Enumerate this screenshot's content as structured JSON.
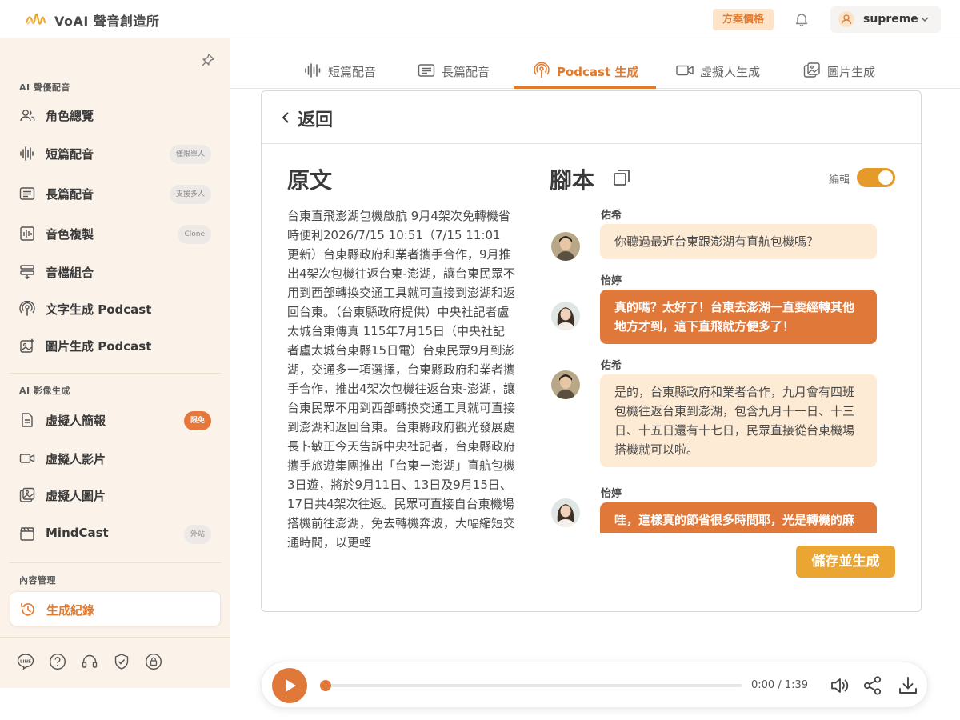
{
  "header": {
    "app_title": "VoAI 聲音創造所",
    "pricing_label": "方案價格",
    "user_name": "supreme"
  },
  "sidebar": {
    "sections": [
      {
        "title": "AI 聲優配音"
      },
      {
        "title": "AI 影像生成"
      },
      {
        "title": "內容管理"
      }
    ],
    "items": [
      {
        "label": "角色總覽",
        "icon": "users-icon"
      },
      {
        "label": "短篇配音",
        "badge": "僅限單人",
        "icon": "waveform-icon"
      },
      {
        "label": "長篇配音",
        "badge": "支援多人",
        "icon": "list-doc-icon"
      },
      {
        "label": "音色複製",
        "badge": "Clone",
        "icon": "voice-clone-icon"
      },
      {
        "label": "音檔組合",
        "icon": "audio-merge-icon"
      },
      {
        "label": "文字生成 Podcast",
        "icon": "podcast-icon"
      },
      {
        "label": "圖片生成 Podcast",
        "icon": "image-sparkle-icon"
      },
      {
        "label": "虛擬人簡報",
        "badge": "限免",
        "icon": "document-icon"
      },
      {
        "label": "虛擬人影片",
        "icon": "video-icon"
      },
      {
        "label": "虛擬人圖片",
        "icon": "image-icon"
      },
      {
        "label": "MindCast",
        "badge": "外站",
        "icon": "clapper-icon"
      },
      {
        "label": "生成紀錄",
        "icon": "history-icon"
      }
    ]
  },
  "tabs": [
    {
      "label": "短篇配音",
      "icon": "waveform-icon"
    },
    {
      "label": "長篇配音",
      "icon": "list-doc-icon"
    },
    {
      "label": "Podcast 生成",
      "icon": "podcast-icon"
    },
    {
      "label": "虛擬人生成",
      "icon": "video-icon"
    },
    {
      "label": "圖片生成",
      "icon": "image-icon"
    }
  ],
  "panel": {
    "back_label": "返回",
    "original_title": "原文",
    "original_text": "台東直飛澎湖包機啟航 9月4架次免轉機省時便利2026/7/15 10:51（7/15 11:01 更新）台東縣政府和業者攜手合作，9月推出4架次包機往返台東-澎湖，讓台東民眾不用到西部轉換交通工具就可直接到澎湖和返回台東。（台東縣政府提供）中央社記者盧太城台東傳真 115年7月15日（中央社記者盧太城台東縣15日電）台東民眾9月到澎湖，交通多一項選擇，台東縣政府和業者攜手合作，推出4架次包機往返台東-澎湖，讓台東民眾不用到西部轉換交通工具就可直接到澎湖和返回台東。台東縣政府觀光發展處長卜敏正今天告訴中央社記者，台東縣政府攜手旅遊集團推出「台東ㄧ澎湖」直航包機3日遊，將於9月11日、13日及9月15日、17日共4架次往返。民眾可直接自台東機場搭機前往澎湖，免去轉機奔波，大幅縮短交通時間，以更輕",
    "script_title": "腳本",
    "edit_label": "編輯",
    "edit_enabled": true,
    "dialogue": [
      {
        "speaker": "佑希",
        "text": "你聽過最近台東跟澎湖有直航包機嗎？",
        "style": "light"
      },
      {
        "speaker": "怡婷",
        "text": "真的嗎？太好了！台東去澎湖一直要經轉其他地方才到，這下直飛就方便多了！",
        "style": "dark"
      },
      {
        "speaker": "佑希",
        "text": "是的，台東縣政府和業者合作，九月會有四班包機往返台東到澎湖，包含九月十一日、十三日、十五日還有十七日，民眾直接從台東機場搭機就可以啦。",
        "style": "light"
      },
      {
        "speaker": "怡婷",
        "text": "哇，這樣真的節省很多時間耶，光是轉機的麻煩就少掉一大半！那包機還有包含什麼行程嗎？",
        "style": "dark"
      }
    ],
    "save_button": "儲存並生成"
  },
  "player": {
    "time": "0:00 / 1:39",
    "progress": 0
  },
  "colors": {
    "accent": "#e0783a",
    "accent_light": "#fdebd5",
    "sidebar_bg": "#fbf3ea",
    "save_button": "#eba532"
  }
}
